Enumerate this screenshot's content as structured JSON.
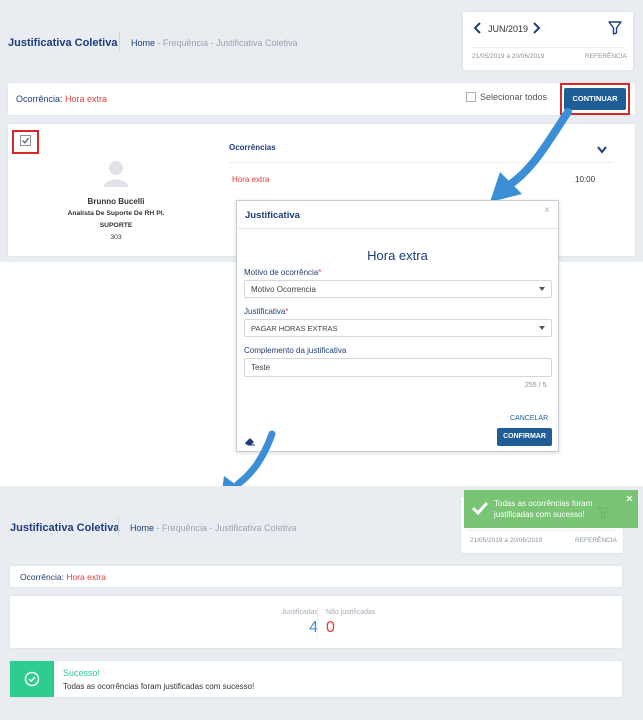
{
  "top": {
    "title": "Justificativa Coletiva",
    "breadcrumb_home": "Home",
    "breadcrumb_rest": " - Frequência - Justificativa Coletiva",
    "period_month": "JUN/2019",
    "period_range": "21/05/2019 a 20/06/2019",
    "reference_label": "REFERÊNCIA",
    "ocorrencia_label": "Ocorrência:",
    "ocorrencia_value": "Hora extra",
    "select_all_label": "Selecionar todos",
    "continue_label": "CONTINUAR",
    "employee_name": "Brunno Bucelli",
    "employee_role": "Analista De Suporte De RH Pl.",
    "employee_dept": "SUPORTE",
    "employee_code": "303",
    "ocorrencias_header": "Ocorrências",
    "ocorrencia_item": "Hora extra",
    "ocorrencia_time": "10:00"
  },
  "modal": {
    "title": "Justificativa",
    "close": "×",
    "heading": "Hora extra",
    "motivo_label": "Motivo de ocorrência",
    "required_mark": "*",
    "motivo_value": "Motivo Ocorrencia",
    "justificativa_label": "Justificativa",
    "justificativa_value": "PAGAR HORAS EXTRAS",
    "complemento_label": "Complemento da justificativa",
    "complemento_value": "Teste",
    "counter": "255 / 5",
    "cancel_label": "CANCELAR",
    "confirm_label": "CONFIRMAR"
  },
  "bottom": {
    "title": "Justificativa Coletiva",
    "breadcrumb_home": "Home",
    "breadcrumb_rest": " - Frequência - Justificativa Coletiva",
    "period_range": "21/05/2019 a 20/06/2019",
    "reference_label": "REFERÊNCIA",
    "toast_text": "Todas as ocorrências foram justificadas com sucesso!",
    "ocorrencia_label": "Ocorrência:",
    "ocorrencia_value": "Hora extra",
    "justificadas_label": "Justificadas",
    "justificadas_value": "4",
    "nao_justificadas_label": "Não justificadas",
    "nao_justificadas_value": "0",
    "success_title": "Sucesso!",
    "success_text": "Todas as ocorrências foram justificadas com sucesso!"
  },
  "colors": {
    "navy": "#1f3d7a",
    "red": "#e0403c",
    "green": "#2ecc8f",
    "toast_green": "#6fbf6a",
    "arrow_blue": "#3b8fd6",
    "highlight_red": "#d62828"
  },
  "icons": [
    "chevron-left-icon",
    "chevron-right-icon",
    "filter-icon",
    "chevron-down-icon",
    "user-avatar-icon",
    "eraser-icon",
    "check-icon",
    "close-icon"
  ]
}
